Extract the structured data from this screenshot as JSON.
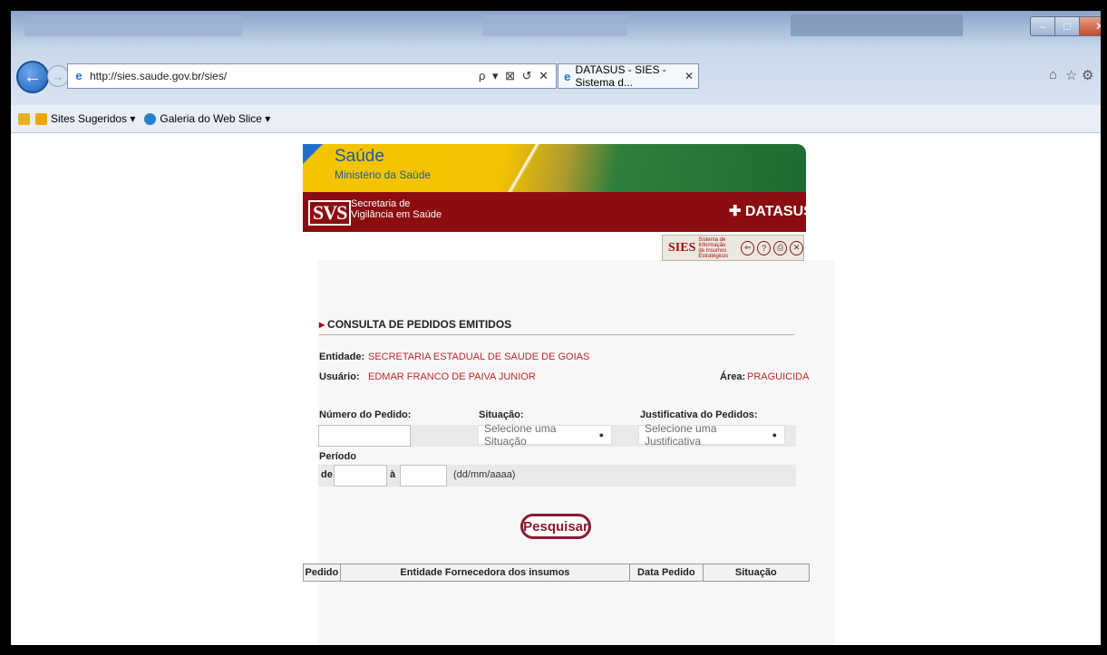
{
  "browser": {
    "address_url": "http://sies.saude.gov.br/sies/",
    "address_tools": "ρ ▾ ⊠ ↺ ✕",
    "tab_title": "DATASUS - SIES - Sistema d...",
    "tab_close": "✕",
    "window_controls": {
      "minimize": "–",
      "maximize": "□",
      "close": "✕"
    },
    "favorites": [
      "Sites Sugeridos ▾",
      "Galeria do Web Slice ▾"
    ]
  },
  "banner": {
    "saude": "Saúde",
    "ministerio": "Ministério da Saúde",
    "svs_logo": "SVS",
    "svs_line1": "Secretaria de",
    "svs_line2": "Vigilância em Saúde",
    "datasus": "DATASUS",
    "sies": "SIES",
    "sies_sub": "Sistema de Informação de Insumos Estratégicos"
  },
  "form": {
    "section_title": "CONSULTA DE PEDIDOS EMITIDOS",
    "entidade_label": "Entidade:",
    "entidade_value": "SECRETARIA ESTADUAL DE SAUDE DE GOIAS",
    "usuario_label": "Usuário:",
    "usuario_value": "EDMAR FRANCO DE PAIVA JUNIOR",
    "area_label": "Área:",
    "area_value": "PRAGUICIDA",
    "numero_label": "Número do Pedido:",
    "situacao_label": "Situação:",
    "situacao_selected": "Selecione uma Situação",
    "justificativa_label": "Justificativa do Pedidos:",
    "justificativa_selected": "Selecione uma Justificativa",
    "periodo_label": "Período",
    "de_label": "de",
    "a_label": "à",
    "date_hint": "(dd/mm/aaaa)",
    "search_button": "Pesquisar"
  },
  "table": {
    "columns": [
      "Pedido",
      "Entidade Fornecedora dos insumos",
      "Data Pedido",
      "Situação"
    ]
  }
}
